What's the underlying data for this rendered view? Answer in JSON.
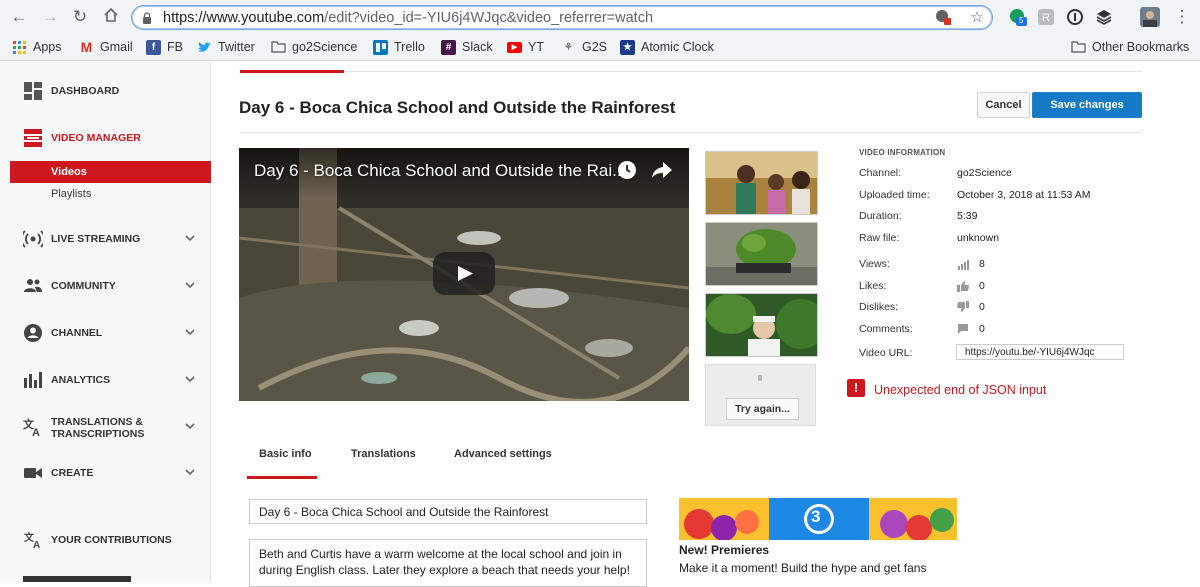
{
  "browser": {
    "url_host": "https://www.youtube.com",
    "url_path": "/edit?video_id=-YIU6j4WJqc&video_referrer=watch",
    "extension_badge": "5",
    "bookmarks": [
      {
        "label": "Apps",
        "icon": "apps-grid-icon"
      },
      {
        "label": "Gmail",
        "icon": "gmail-icon"
      },
      {
        "label": "FB",
        "icon": "facebook-icon"
      },
      {
        "label": "Twitter",
        "icon": "twitter-icon"
      },
      {
        "label": "go2Science",
        "icon": "folder-icon"
      },
      {
        "label": "Trello",
        "icon": "trello-icon"
      },
      {
        "label": "Slack",
        "icon": "slack-icon"
      },
      {
        "label": "YT",
        "icon": "youtube-icon"
      },
      {
        "label": "G2S",
        "icon": "g2s-icon"
      },
      {
        "label": "Atomic Clock",
        "icon": "star-icon"
      }
    ],
    "other_bookmarks": "Other Bookmarks"
  },
  "sidebar": {
    "items": [
      {
        "label": "DASHBOARD",
        "icon": "dashboard-icon"
      },
      {
        "label": "VIDEO MANAGER",
        "icon": "video-manager-icon"
      },
      {
        "label": "LIVE STREAMING",
        "icon": "live-streaming-icon"
      },
      {
        "label": "COMMUNITY",
        "icon": "community-icon"
      },
      {
        "label": "CHANNEL",
        "icon": "channel-icon"
      },
      {
        "label": "ANALYTICS",
        "icon": "analytics-icon"
      },
      {
        "label": "TRANSLATIONS &",
        "label2": "TRANSCRIPTIONS",
        "icon": "translate-icon"
      },
      {
        "label": "CREATE",
        "icon": "create-icon"
      },
      {
        "label": "YOUR CONTRIBUTIONS",
        "icon": "contributions-icon"
      }
    ],
    "sub_items": [
      "Videos",
      "Playlists"
    ]
  },
  "main": {
    "title": "Day 6 - Boca Chica School and Outside the Rainforest",
    "cancel_label": "Cancel",
    "save_label": "Save changes",
    "player_title": "Day 6 - Boca Chica School and Outside the Rai...",
    "try_again": "Try again...",
    "info": {
      "heading": "VIDEO INFORMATION",
      "channel_label": "Channel:",
      "channel": "go2Science",
      "uploaded_label": "Uploaded time:",
      "uploaded": "October 3, 2018 at 11:53 AM",
      "duration_label": "Duration:",
      "duration": "5:39",
      "raw_label": "Raw file:",
      "raw": "unknown",
      "views_label": "Views:",
      "views": "8",
      "likes_label": "Likes:",
      "likes": "0",
      "dislikes_label": "Dislikes:",
      "dislikes": "0",
      "comments_label": "Comments:",
      "comments": "0",
      "url_label": "Video URL:",
      "url": "https://youtu.be/-YIU6j4WJqc"
    },
    "error": "Unexpected end of JSON input",
    "tabs": [
      "Basic info",
      "Translations",
      "Advanced settings"
    ],
    "title_field": "Day 6 -  Boca Chica School and Outside the Rainforest",
    "description_line1": "Beth and Curtis have a warm welcome at the local school and join in",
    "description_line2": "during English class.  Later they explore a beach that needs your help!",
    "promo": {
      "number": "3",
      "title": "New! Premieres",
      "text": "Make it a moment! Build the hype and get fans"
    }
  },
  "colors": {
    "accent_red": "#cc181e",
    "save_blue": "#167ac6"
  }
}
